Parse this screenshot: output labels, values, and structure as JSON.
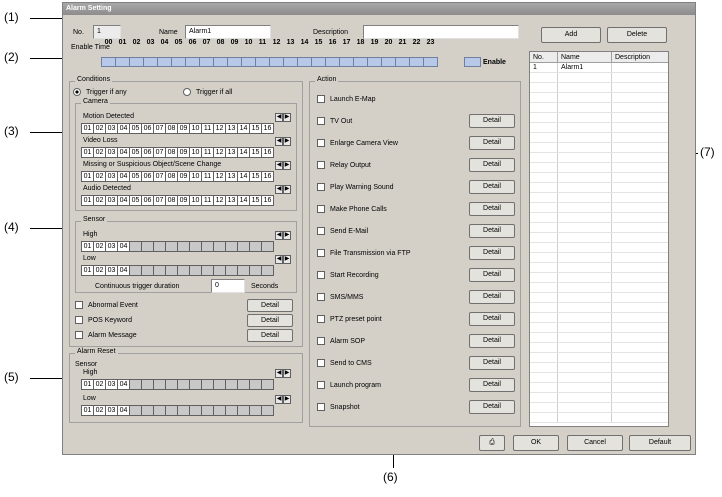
{
  "window": {
    "title": "Alarm Setting"
  },
  "header": {
    "no_label": "No.",
    "no_value": "1",
    "name_label": "Name",
    "name_value": "Alarm1",
    "desc_label": "Description",
    "desc_value": ""
  },
  "buttons": {
    "add": "Add",
    "delete": "Delete",
    "ok": "OK",
    "cancel": "Cancel",
    "default": "Default",
    "detail": "Detail"
  },
  "enable_time": {
    "label": "Enable Time",
    "hours": [
      "00",
      "01",
      "02",
      "03",
      "04",
      "05",
      "06",
      "07",
      "08",
      "09",
      "10",
      "11",
      "12",
      "13",
      "14",
      "15",
      "16",
      "17",
      "18",
      "19",
      "20",
      "21",
      "22",
      "23"
    ],
    "enable_label": "Enable"
  },
  "conditions": {
    "label": "Conditions",
    "trigger_any": "Trigger if any",
    "trigger_all": "Trigger if all",
    "selected": "any",
    "camera_label": "Camera",
    "camera_items": [
      "Motion Detected",
      "Video Loss",
      "Missing or Suspicious Object/Scene Change",
      "Audio Detected"
    ],
    "camera_cells": [
      "01",
      "02",
      "03",
      "04",
      "05",
      "06",
      "07",
      "08",
      "09",
      "10",
      "11",
      "12",
      "13",
      "14",
      "15",
      "16"
    ],
    "sensor_label": "Sensor",
    "high_label": "High",
    "low_label": "Low",
    "sensor_cells": [
      "01",
      "02",
      "03",
      "04"
    ],
    "duration_label": "Continuous trigger duration",
    "duration_value": "0",
    "seconds_label": "Seconds",
    "extra_items": [
      "Abnormal Event",
      "POS Keyword",
      "Alarm Message"
    ]
  },
  "alarm_reset": {
    "label": "Alarm Reset",
    "sensor_label": "Sensor",
    "high_label": "High",
    "low_label": "Low"
  },
  "action": {
    "label": "Action",
    "items": [
      {
        "label": "Launch E-Map",
        "detail": false
      },
      {
        "label": "TV Out",
        "detail": true
      },
      {
        "label": "Enlarge Camera View",
        "detail": true
      },
      {
        "label": "Relay Output",
        "detail": true
      },
      {
        "label": "Play Warning Sound",
        "detail": true
      },
      {
        "label": "Make Phone Calls",
        "detail": true
      },
      {
        "label": "Send E-Mail",
        "detail": true
      },
      {
        "label": "File Transmission via FTP",
        "detail": true
      },
      {
        "label": "Start Recording",
        "detail": true
      },
      {
        "label": "SMS/MMS",
        "detail": true
      },
      {
        "label": "PTZ preset point",
        "detail": true
      },
      {
        "label": "Alarm SOP",
        "detail": true
      },
      {
        "label": "Send to CMS",
        "detail": true
      },
      {
        "label": "Launch program",
        "detail": true
      },
      {
        "label": "Snapshot",
        "detail": true
      }
    ]
  },
  "alarm_list": {
    "columns": [
      "No.",
      "Name",
      "Description"
    ],
    "rows": [
      [
        "1",
        "Alarm1",
        ""
      ]
    ]
  },
  "callouts": [
    "(1)",
    "(2)",
    "(3)",
    "(4)",
    "(5)",
    "(6)",
    "(7)"
  ]
}
